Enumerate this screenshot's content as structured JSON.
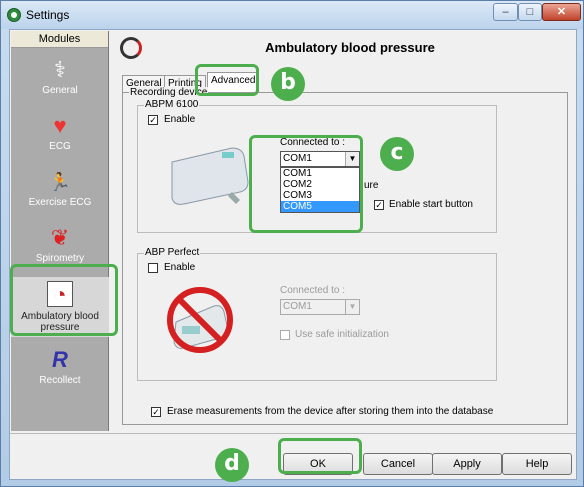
{
  "window": {
    "title": "Settings",
    "min_glyph": "–",
    "max_glyph": "□",
    "close_glyph": "✕"
  },
  "sidebar": {
    "header": "Modules",
    "items": [
      {
        "label": "General",
        "icon": "stethoscope-icon",
        "glyph": "⚕"
      },
      {
        "label": "ECG",
        "icon": "ecg-heart-icon",
        "glyph": "♥"
      },
      {
        "label": "Exercise ECG",
        "icon": "runner-icon",
        "glyph": "🏃"
      },
      {
        "label": "Spirometry",
        "icon": "lungs-icon",
        "glyph": "❦"
      },
      {
        "label": "Ambulatory blood pressure",
        "icon": "blood-pressure-icon",
        "glyph": "◔"
      },
      {
        "label": "Recollect",
        "icon": "recollect-icon",
        "glyph": "R"
      }
    ],
    "selected_index": 4
  },
  "header": {
    "title": "Ambulatory blood pressure"
  },
  "tabs": [
    {
      "label": "General"
    },
    {
      "label": "Printing"
    },
    {
      "label": "Advanced"
    }
  ],
  "active_tab": "Advanced",
  "recording_device": {
    "legend": "Recording device",
    "abpm": {
      "legend": "ABPM 6100",
      "enable_label": "Enable",
      "enable_checked": true,
      "connected_label": "Connected to :",
      "selected_port": "COM1",
      "dropdown_options": [
        "COM1",
        "COM2",
        "COM3",
        "COM5"
      ],
      "highlighted_option": "COM5",
      "partial_text": "ure",
      "start_button_label": "Enable start button",
      "start_button_checked": true
    },
    "abp_perfect": {
      "legend": "ABP Perfect",
      "enable_label": "Enable",
      "enable_checked": false,
      "connected_label": "Connected to :",
      "selected_port": "COM1",
      "safe_init_label": "Use safe initialization"
    },
    "erase_label": "Erase measurements from the device after storing them into the database",
    "erase_checked": true
  },
  "footer": {
    "ok": "OK",
    "cancel": "Cancel",
    "apply": "Apply",
    "help": "Help"
  },
  "callouts": {
    "b": "b",
    "c": "c",
    "d": "d"
  },
  "colors": {
    "callout_green": "#4cae4c",
    "selection_blue": "#3399ff",
    "sidebar_gray": "#ababab"
  }
}
